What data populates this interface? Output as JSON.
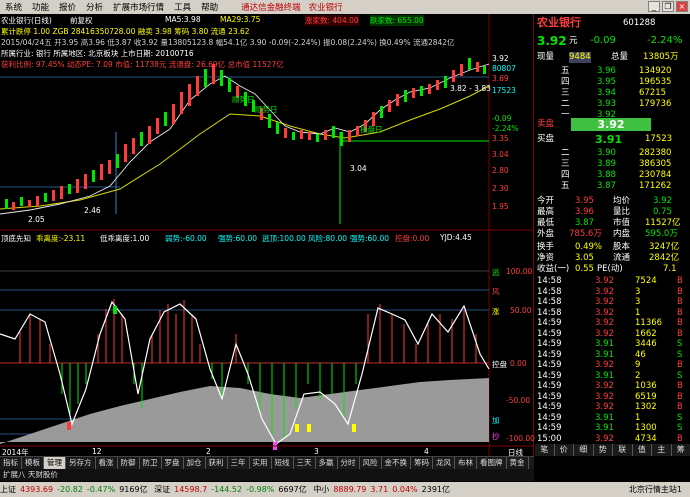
{
  "menu": {
    "items": [
      "系统",
      "功能",
      "报价",
      "分析",
      "扩展市场行情",
      "工具",
      "帮助"
    ],
    "promo": "通达信金融终端",
    "stock_label": "农业银行"
  },
  "main_chart": {
    "title": "农业银行(日线)",
    "rights": "前复权",
    "ma5_label": "MA5:",
    "ma5": "3.98",
    "ma29_label": "MA29:",
    "ma29": "3.75",
    "limit_text": "涨家数: 404.00",
    "fall_text": "跌家数: 655.00",
    "row2": "累计跌停 1.00   ZGB 28416350728.00   融卖 3.98   筹码 3.80   流通 23.62",
    "row3": "2015/04/24五 开3.95 高3.96 低3.87 收3.92 量13805123.8 幅54.1亿 3.90 -0.09(-2.24%) 振0.08(2.24%) 换0.49% 流通2842亿",
    "row4": "所属行业: 银行    所属地区: 北京板块    上市日期: 20100716",
    "row5": "获利比例: 97.45%   动态PE: 7.09    市值: 11738元   流通盘: 26.69亿   总市值 11527亿",
    "price_ticks": [
      "3.92",
      "80807",
      "3.69",
      "17523",
      "-0.09",
      "-2.24%",
      "3.35",
      "3.04",
      "2.80",
      "2.30",
      "1.95"
    ],
    "annotations": [
      "3.82 - 3.83",
      "顺势日",
      "顺势日",
      "操盘日",
      "3.04",
      "2.05",
      "2.46"
    ]
  },
  "indicator": {
    "title": "顶底先知",
    "v1_label": "乖离度:",
    "v1": "-23.11",
    "v2_label": "低乖离度:",
    "v2": "1.00",
    "v3_label": "弱势:",
    "v3": "-60.00",
    "v4_label": "强势:",
    "v4": "60.00",
    "v5_label": "逃顶:",
    "v5": "100.00",
    "v6_label": "风险:",
    "v6": "80.00",
    "v7_label": "强势:",
    "v7": "60.00",
    "v8_label": "控盘:",
    "v8": "0.00",
    "v9_label": "YJD:",
    "v9": "4.45",
    "right_labels": [
      "100.00",
      "50.00",
      "0.00",
      "-50.00",
      "-100.00"
    ],
    "line_labels": [
      "逃",
      "风",
      "涨",
      "控盘",
      "加",
      "抄"
    ]
  },
  "xaxis": {
    "labels": [
      "2014年",
      "12",
      "2",
      "3",
      "4",
      "日线"
    ]
  },
  "quote": {
    "name": "农业银行",
    "code": "601288",
    "price": "3.92",
    "unit": "元",
    "change": "-0.09",
    "change_pct": "-2.24%",
    "xian_liang_label": "现量",
    "xian_liang": "9484",
    "zong_liang_label": "总量",
    "zong_liang": "13805万",
    "asks": [
      {
        "label": "五",
        "price": "3.96",
        "vol": "134920"
      },
      {
        "label": "四",
        "price": "3.95",
        "vol": "196535"
      },
      {
        "label": "三",
        "price": "3.94",
        "vol": "67215"
      },
      {
        "label": "二",
        "price": "3.93",
        "vol": "179736"
      },
      {
        "label": "一",
        "price": "3.92",
        "vol": ""
      }
    ],
    "sell_label": "卖盘",
    "sell_price": "3.92",
    "buy_label": "买盘",
    "buy_price": "3.91",
    "buy_vol": "17523",
    "bids": [
      {
        "label": "二",
        "price": "3.90",
        "vol": "282380"
      },
      {
        "label": "三",
        "price": "3.89",
        "vol": "386305"
      },
      {
        "label": "四",
        "price": "3.88",
        "vol": "230784"
      },
      {
        "label": "五",
        "price": "3.87",
        "vol": "171262"
      }
    ],
    "stats": [
      {
        "l1": "今开",
        "v1": "3.95",
        "l2": "均价",
        "v2": "3.92"
      },
      {
        "l1": "最高",
        "v1": "3.96",
        "l2": "量比",
        "v2": "0.75"
      },
      {
        "l1": "最低",
        "v1": "3.87",
        "l2": "市值",
        "v2": "11527亿"
      },
      {
        "l1": "外盘",
        "v1": "785.6万",
        "l2": "内盘",
        "v2": "595.0万"
      },
      {
        "l1": "换手",
        "v1": "0.49%",
        "l2": "股本",
        "v2": "3247亿"
      },
      {
        "l1": "净资",
        "v1": "3.05",
        "l2": "流通",
        "v2": "2842亿"
      },
      {
        "l1": "收益(一)",
        "v1": "0.55",
        "l2": "PE(动)",
        "v2": "7.1"
      }
    ],
    "ticks": [
      {
        "time": "14:58",
        "price": "3.92",
        "vol": "7524",
        "dir": "B"
      },
      {
        "time": "14:58",
        "price": "3.92",
        "vol": "3",
        "dir": "B"
      },
      {
        "time": "14:58",
        "price": "3.92",
        "vol": "3",
        "dir": "B"
      },
      {
        "time": "14:58",
        "price": "3.92",
        "vol": "1",
        "dir": "B"
      },
      {
        "time": "14:59",
        "price": "3.92",
        "vol": "11366",
        "dir": "B"
      },
      {
        "time": "14:59",
        "price": "3.92",
        "vol": "1662",
        "dir": "B"
      },
      {
        "time": "14:59",
        "price": "3.91",
        "vol": "3446",
        "dir": "S"
      },
      {
        "time": "14:59",
        "price": "3.91",
        "vol": "46",
        "dir": "S"
      },
      {
        "time": "14:59",
        "price": "3.92",
        "vol": "9",
        "dir": "B"
      },
      {
        "time": "14:59",
        "price": "3.91",
        "vol": "2",
        "dir": "S"
      },
      {
        "time": "14:59",
        "price": "3.92",
        "vol": "1036",
        "dir": "B"
      },
      {
        "time": "14:59",
        "price": "3.92",
        "vol": "6519",
        "dir": "B"
      },
      {
        "time": "14:59",
        "price": "3.92",
        "vol": "1302",
        "dir": "B"
      },
      {
        "time": "14:59",
        "price": "3.91",
        "vol": "1",
        "dir": "S"
      },
      {
        "time": "14:59",
        "price": "3.91",
        "vol": "1300",
        "dir": "S"
      },
      {
        "time": "15:00",
        "price": "3.92",
        "vol": "4734",
        "dir": "B"
      }
    ],
    "bottom_tabs": [
      "笔",
      "价",
      "细",
      "势",
      "联",
      "值",
      "主",
      "筹"
    ]
  },
  "tabs": [
    "指标",
    "模板",
    "管理",
    "另存方",
    "看涨",
    "防御",
    "防卫",
    "罗盘",
    "加仓",
    "获利",
    "三年",
    "实用",
    "短线",
    "三天",
    "多赢",
    "分时",
    "风险",
    "金不换",
    "筹码",
    "龙风",
    "布林",
    "看图牌",
    "黄金"
  ],
  "subbar": "扩展八 天财股价",
  "status": {
    "sh_label": "上证",
    "sh": "4393.69",
    "sh_chg": "-20.82",
    "sh_pct": "-0.47%",
    "sh_vol": "9169亿",
    "sz_label": "深证",
    "sz": "14598.7",
    "sz_chg": "-144.52",
    "sz_pct": "-0.98%",
    "sz_vol": "6697亿",
    "zx_label": "中小",
    "zx": "8889.79",
    "zx_chg": "3.71",
    "zx_pct": "0.04%",
    "zx_vol": "2391亿",
    "server": "北京行情主站1"
  },
  "colors": {
    "up": "#ff3c3c",
    "down": "#00e600",
    "accent": "#ffff00",
    "bg": "#000000"
  }
}
